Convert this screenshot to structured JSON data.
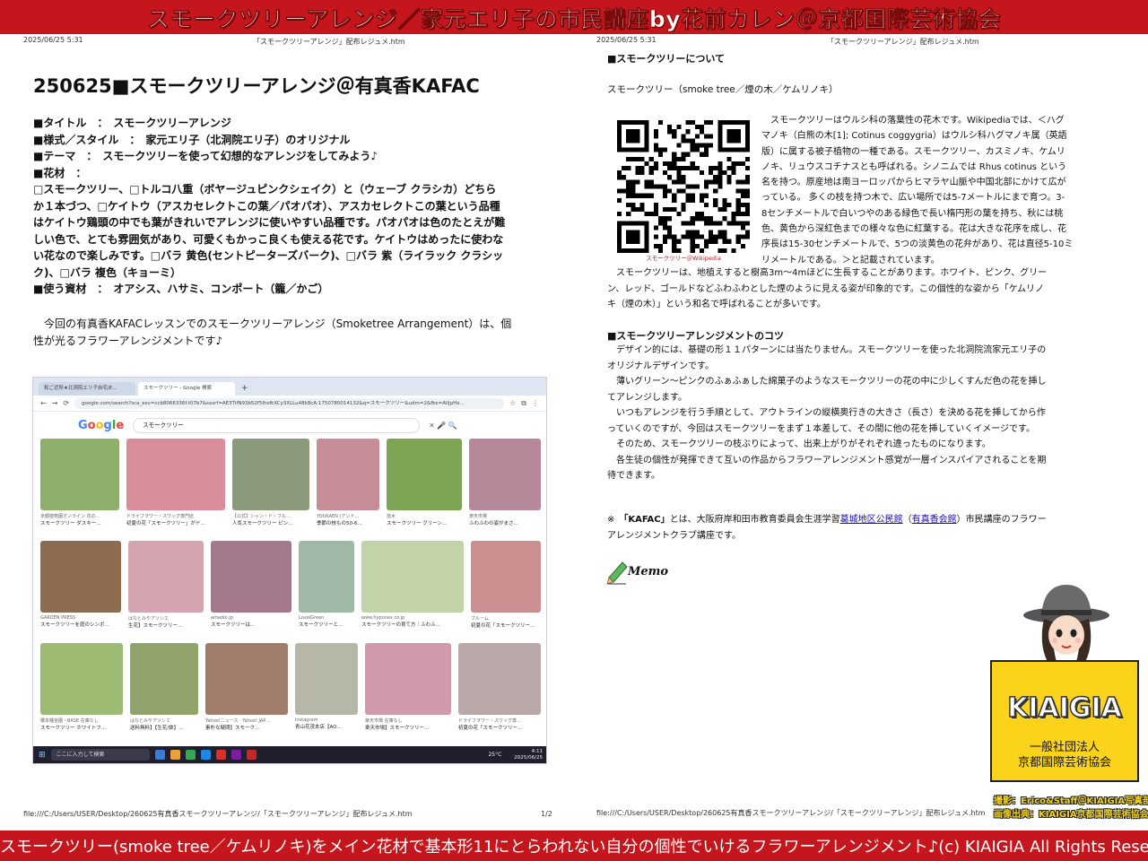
{
  "banner": {
    "title": "スモークツリーアレンジ／家元エリ子の市民講座by花前カレン＠京都国際芸術協会",
    "caption": "スモークツリー(smoke tree／ケムリノキ)をメイン花材で基本形11にとらわれない自分の個性でいけるフラワーアレンジメント♪(c) KIAIGIA All Rights Reserved."
  },
  "page_left": {
    "date": "2025/06/25 5:31",
    "doc_name": "「スモークツリーアレンジ」配布レジュメ.htm",
    "title": "250625■スモークツリーアレンジ＠有真香KAFAC",
    "lines": [
      "■タイトル　：　スモークツリーアレンジ",
      "■様式／スタイル　：　家元エリ子（北洞院エリ子）のオリジナル",
      "■テーマ　：　スモークツリーを使って幻想的なアレンジをしてみよう♪",
      "■花材　：",
      "□スモークツリー、□トルコ八重（ボヤージュピンクシェイク）と（ウェーブ クラシカ）どちら",
      "か１本づつ、□ケイトウ（アスカセレクトこの葉／パオパオ）、アスカセレクトこの葉という品種",
      "はケイトウ鶏頭の中でも葉がきれいでアレンジに使いやすい品種です。パオパオは色のたとえが難",
      "しい色で、とても雰囲気があり、可愛くもかっこ良くも使える花です。ケイトウはめったに使わな",
      "い花なので楽しみです。□バラ 黄色(セントピーターズバーク)、□バラ 紫（ライラック クラシッ",
      "ク)、□バラ 複色（キョーミ）",
      "■使う資材　：　オアシス、ハサミ、コンポート（籠／かご）"
    ],
    "intro": [
      "　今回の有真香KAFACレッスンでのスモークツリーアレンジ（Smoketree Arrangement）は、個",
      "性が光るフラワーアレンジメントです♪"
    ],
    "footer_path": "file:///C:/Users/USER/Desktop/260625有真香スモークツリーアレンジ/「スモークツリーアレンジ」配布レジュメ.htm",
    "page": "1/2"
  },
  "browser": {
    "tabs": [
      "和ご近所★北洞院エリ子自宅/E…",
      "スモークツリー - Google 検索"
    ],
    "url": "google.com/search?sca_esv=ccb8066336f.t07b7&sxsrf=AE3TifN93b52f5lhsfkXCy3XLLu48k8cA:1750780014132&q=スモークツリー&udm=2&fbs=AIljpHx…",
    "logo": [
      "G",
      "o",
      "o",
      "g",
      "l",
      "e"
    ],
    "query": "スモークツリー",
    "rows": [
      [
        {
          "src": "京都植物園オンライン 花の…",
          "title": "スモークツリー ダスキー…",
          "color": "#8fae6b"
        },
        {
          "src": "ドライフラワー・スワッグ専門店",
          "title": "初夏の花「スモークツリー」がド…",
          "color": "#d98c9a"
        },
        {
          "src": "【公式】シャン・ド・フル…",
          "title": "人気スモークツリー ピン…",
          "color": "#8a9a7a"
        },
        {
          "src": "YOUKAEN (アンド…",
          "title": "季節の枝もの50-6…",
          "color": "#c58d98"
        },
        {
          "src": "苗木",
          "title": "スモークツリー グリーン…",
          "color": "#7ea553"
        },
        {
          "src": "楽天市場",
          "title": "ふわふわの姿がまさ…",
          "color": "#b7889a"
        }
      ],
      [
        {
          "src": "GARDEN PRESS",
          "title": "スモークツリーを庭のシンボ…",
          "color": "#8d6b50"
        },
        {
          "src": "はなとみやアソシエ",
          "title": "生花】スモークツリー…",
          "color": "#d6a3b0"
        },
        {
          "src": "amadoi.jp",
          "title": "スモークツリーは…",
          "color": "#a4798e"
        },
        {
          "src": "LovelGreen",
          "title": "スモークツリーと…",
          "color": "#a0b9a6"
        },
        {
          "src": "www.hyponex.co.jp",
          "title": "スモークツリーの育て方｜ふわふ…",
          "color": "#c3d3a8"
        },
        {
          "src": "ブルーム",
          "title": "初夏の花「スモークツリー…",
          "color": "#cc8f8f"
        }
      ],
      [
        {
          "src": "橋本種苗園・BASE 在庫なし",
          "title": "スモークツリー ホワイトフ…",
          "color": "#9dbb72"
        },
        {
          "src": "はなとみやアソシエ",
          "title": "送料無料】【生花/鉢】…",
          "color": "#8fa36b"
        },
        {
          "src": "Yahoo!ニュース · Yahoo! JAP…",
          "title": "素朴な疑問】スモーク…",
          "color": "#a07c6a"
        },
        {
          "src": "Instagram",
          "title": "青山花茂本店【AO…",
          "color": "#b6b7a6"
        },
        {
          "src": "楽天市場 在庫なし",
          "title": "楽天市場】スモークツリー…",
          "color": "#cf9aab"
        },
        {
          "src": "ドライフラワー・スワッグ専…",
          "title": "初夏の花「スモークツリー…",
          "color": "#b8a9a8"
        }
      ]
    ],
    "taskbar_search": "ここに入力して検索",
    "taskbar_temp": "25°C",
    "clock_time": "4:11",
    "clock_date": "2025/06/25"
  },
  "page_right": {
    "date": "2025/06/25 5:31",
    "doc_name": "「スモークツリーアレンジ」配布レジュメ.htm",
    "h_about": "■スモークツリーについて",
    "about_name": "スモークツリー（smoke tree／煙の木／ケムリノキ）",
    "qr_caption": "スモークツリー＠Wikipedia",
    "wiki_lines": [
      "　スモークツリーはウルシ科の落葉性の花木です。Wikipediaでは、＜ハグ",
      "マノキ（白熊の木[1]; Cotinus coggygria）はウルシ科ハグマノキ属（英語",
      "版）に属する被子植物の一種である。スモークツリー、カスミノキ、ケムリ",
      "ノキ、リュウスコチナスとも呼ばれる。シノニムでは Rhus cotinus という",
      "名を持つ。原産地は南ヨーロッパからヒマラヤ山脈や中国北部にかけて広が",
      "っている。 多くの枝を持つ木で、広い場所では5-7メートルにまで育つ。3-",
      "8センチメートルで白いつやのある緑色で長い楕円形の葉を持ち、秋には桃",
      "色、黄色から深紅色までの様々な色に紅葉する。花は大きな花序を成し、花",
      "序長は15-30センチメートルで、5つの淡黄色の花弁があり、花は直径5-10ミ",
      "リメートルである。＞と記載されています。"
    ],
    "grow_lines": [
      "　スモークツリーは、地植えすると樹高3m～4mほどに生長することがあります。ホワイト、ピンク、グリー",
      "ン、レッド、ゴールドなどふわふわとした煙のように見える姿が印象的です。この個性的な姿から「ケムリノ",
      "キ（煙の木）」という和名で呼ばれることが多いです。"
    ],
    "h_tips": "■スモークツリーアレンジメントのコツ",
    "tips_lines": [
      "　デザイン的には、基礎の形１１パターンには当たりません。スモークツリーを使った北洞院流家元エリ子の",
      "オリジナルデザインです。",
      "　薄いグリーン～ピンクのふぁふぁした綿菓子のようなスモークツリーの花の中に少しくすんだ色の花を挿し",
      "てアレンジします。",
      "　いつもアレンジを行う手順として、アウトラインの縦横奥行きの大きさ（長さ）を決める花を挿してから作",
      "っていくのですが、今回はスモークツリーをまず１本差して、その間に他の花を挿していくイメージです。",
      "　そのため、スモークツリーの枝ぶりによって、出来上がりがそれぞれ違ったものになります。",
      "　各生徒の個性が発揮できて互いの作品からフラワーアレンジメント感覚が一層インスパイアされることを期",
      "待できます。"
    ],
    "note_prefix": "※　",
    "note_kafac": "「KAFAC」",
    "note_mid": "とは、大阪府岸和田市教育委員会生涯学習",
    "note_link1": "葛城地区公民館",
    "note_paren_open": "（",
    "note_link2": "有真香会館",
    "note_rest": "）市民講座のフラワー",
    "note_line2": "アレンジメントクラブ講座です。",
    "memo": "Memo",
    "footer_path": "file:///C:/Users/USER/Desktop/260625有真香スモークツリーアレンジ/「スモークツリーアレンジ」配布レジュメ.htm"
  },
  "badge": {
    "title": "KIAIGIA",
    "line1": "一般社団法人",
    "line2": "京都国際芸術協会"
  },
  "credits": {
    "line1": "撮影：Erico&Staff＠KIAIGIA写真部",
    "line2": "画像出典：KIAIGIA京都国際芸術協会"
  },
  "colors": {
    "banner": "#c4161c",
    "badge": "#fbd31a",
    "link": "#1a0dab"
  }
}
